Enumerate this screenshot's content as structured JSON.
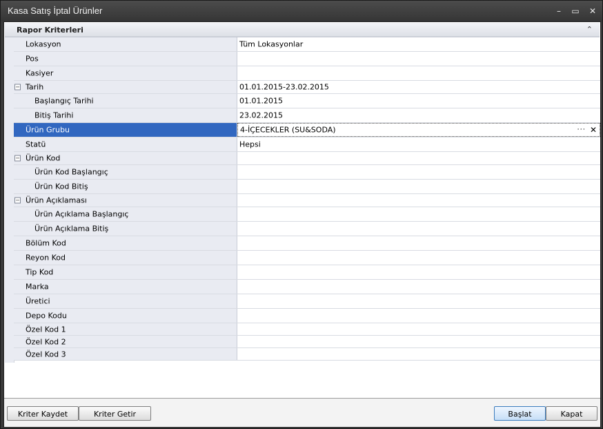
{
  "window": {
    "title": "Kasa Satış İptal Ürünler",
    "controls": {
      "minimize": "–",
      "maximize": "▭",
      "close": "✕"
    }
  },
  "panel": {
    "title": "Rapor Kriterleri",
    "collapse_glyph": "⌃"
  },
  "rows": [
    {
      "label": "Lokasyon",
      "value": "Tüm Lokasyonlar",
      "indent": 0
    },
    {
      "label": "Pos",
      "value": "",
      "indent": 0
    },
    {
      "label": "Kasiyer",
      "value": "",
      "indent": 0
    },
    {
      "label": "Tarih",
      "value": "01.01.2015-23.02.2015",
      "indent": 0,
      "expander": "⊟"
    },
    {
      "label": "Başlangıç Tarihi",
      "value": "01.01.2015",
      "indent": 1
    },
    {
      "label": "Bitiş Tarihi",
      "value": "23.02.2015",
      "indent": 1
    },
    {
      "label": "Ürün Grubu",
      "value": "4-İÇECEKLER (SU&SODA)",
      "indent": 0,
      "selected": true,
      "ellipsis": "···",
      "clear": "✕"
    },
    {
      "label": "Statü",
      "value": "Hepsi",
      "indent": 0
    },
    {
      "label": "Ürün Kod",
      "value": "",
      "indent": 0,
      "expander": "⊟"
    },
    {
      "label": "Ürün Kod Başlangıç",
      "value": "",
      "indent": 1
    },
    {
      "label": "Ürün Kod Bitiş",
      "value": "",
      "indent": 1
    },
    {
      "label": "Ürün Açıklaması",
      "value": "",
      "indent": 0,
      "expander": "⊟"
    },
    {
      "label": "Ürün Açıklama Başlangıç",
      "value": "",
      "indent": 1
    },
    {
      "label": "Ürün Açıklama Bitiş",
      "value": "",
      "indent": 1
    },
    {
      "label": "Bölüm Kod",
      "value": "",
      "indent": 0
    },
    {
      "label": "Reyon Kod",
      "value": "",
      "indent": 0
    },
    {
      "label": "Tip Kod",
      "value": "",
      "indent": 0
    },
    {
      "label": "Marka",
      "value": "",
      "indent": 0
    },
    {
      "label": "Üretici",
      "value": "",
      "indent": 0
    },
    {
      "label": "Depo Kodu",
      "value": "",
      "indent": 0
    },
    {
      "label": "Özel Kod 1",
      "value": "",
      "indent": 0
    },
    {
      "label": "Özel Kod 2",
      "value": "",
      "indent": 0
    },
    {
      "label": "Özel Kod 3",
      "value": "",
      "indent": 0
    }
  ],
  "buttons": {
    "save_criteria": "Kriter Kaydet",
    "load_criteria": "Kriter Getir",
    "start": "Başlat",
    "close": "Kapat"
  },
  "colors": {
    "selected_row": "#3167c0",
    "label_column": "#e9ebf2"
  }
}
